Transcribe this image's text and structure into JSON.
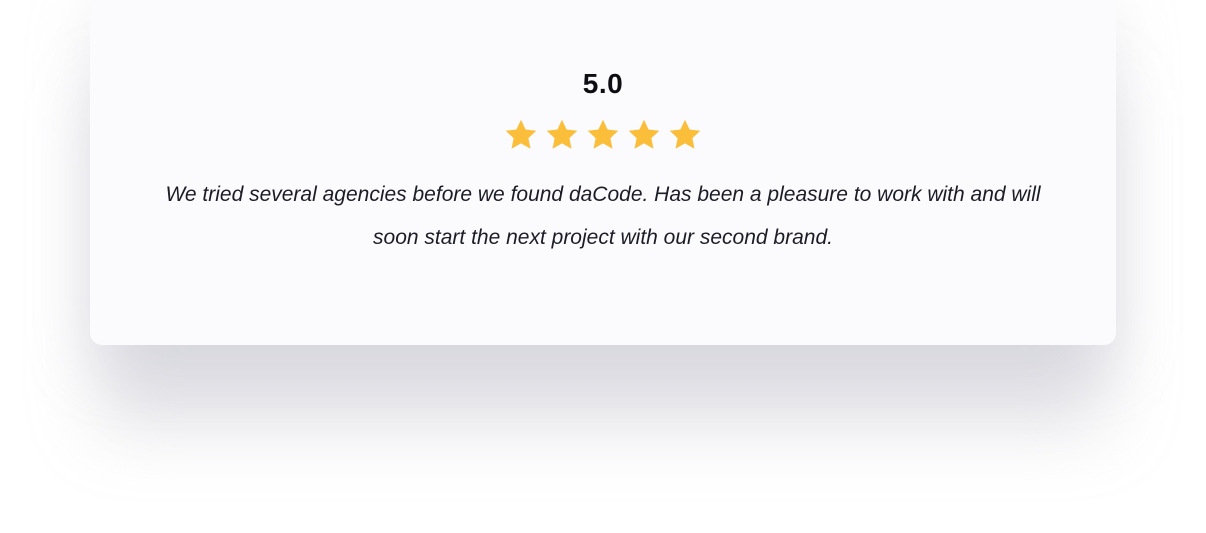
{
  "review": {
    "rating_text": "5.0",
    "rating_value": 5,
    "rating_max": 5,
    "star_color": "#FBBE3A",
    "star_icon": "star-icon",
    "quote": "We tried several agencies before we found daCode. Has been a pleasure to work with and will soon start the next project with our second brand."
  }
}
